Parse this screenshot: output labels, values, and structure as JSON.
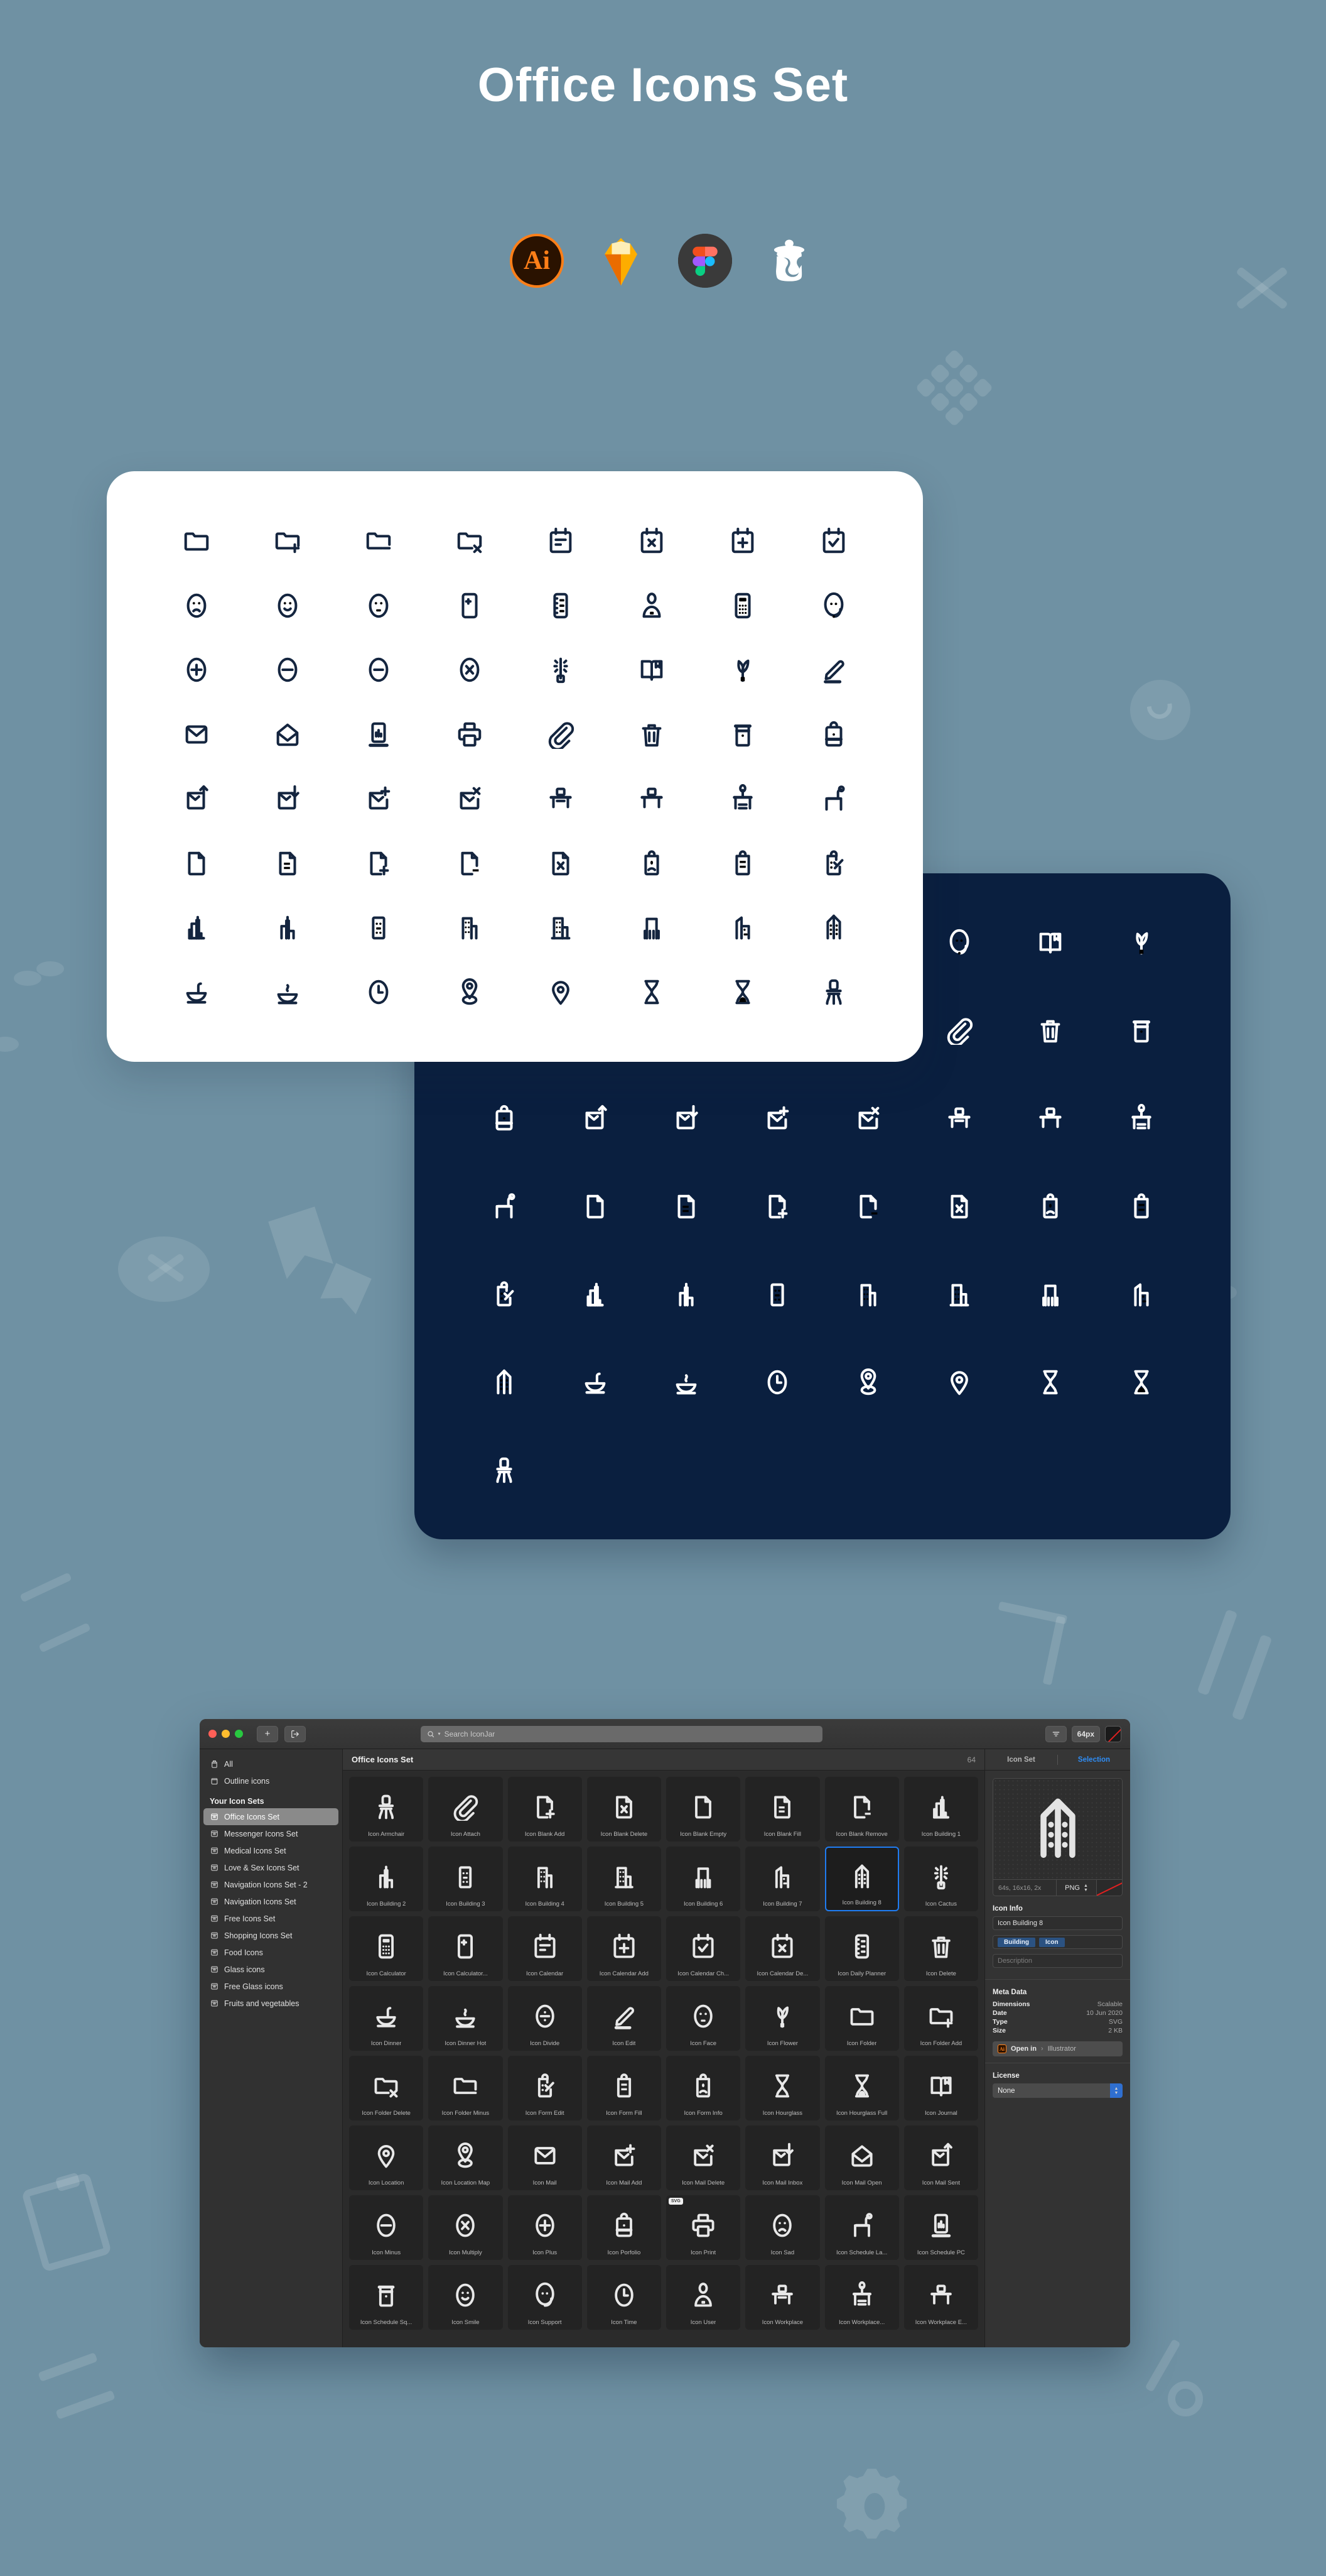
{
  "header": {
    "title": "Office Icons Set",
    "badges": [
      {
        "name": "adobe-illustrator",
        "label": "Ai"
      },
      {
        "name": "sketch",
        "label": "Sketch"
      },
      {
        "name": "figma",
        "label": "Figma"
      },
      {
        "name": "iconjar",
        "label": "IconJar"
      }
    ]
  },
  "cards": {
    "light": {
      "background": "#ffffff",
      "icon_color": "#14253f",
      "icons": [
        "folder",
        "folder-add",
        "folder-minus",
        "folder-delete",
        "calendar",
        "calendar-delete",
        "calendar-add",
        "calendar-check",
        "face-sad",
        "face-smile",
        "face-neutral",
        "calculator-plus-minus",
        "daily-planner",
        "user",
        "calculator",
        "support",
        "plus",
        "minus",
        "minus-2",
        "multiply",
        "cactus",
        "journal",
        "flower",
        "edit",
        "mail",
        "mail-open",
        "schedule-pc",
        "print",
        "attach",
        "delete",
        "schedule-square",
        "portfolio",
        "mail-sent",
        "mail-inbox",
        "mail-add",
        "mail-delete",
        "workplace",
        "workplace-empty",
        "workplace-lamp",
        "schedule-lamp",
        "blank-empty",
        "blank-fill",
        "blank-add",
        "blank-remove",
        "blank-delete",
        "form-info",
        "form-fill",
        "form-edit",
        "building-1",
        "building-2",
        "building-3",
        "building-4",
        "building-5",
        "building-6",
        "building-7",
        "building-8",
        "dinner",
        "dinner-hot",
        "time",
        "location-map",
        "location",
        "hourglass",
        "hourglass-full",
        "armchair"
      ]
    },
    "dark": {
      "background": "#0a1f3f",
      "icon_color": "#ffffff",
      "icons": [
        "calendar-delete",
        "calendar-add",
        "calendar-check",
        "user",
        "calculator",
        "support",
        "journal",
        "flower",
        "edit",
        "mail",
        "mail-open",
        "schedule-pc",
        "print",
        "attach",
        "delete",
        "schedule-square",
        "portfolio",
        "mail-sent",
        "mail-inbox",
        "mail-add",
        "mail-delete",
        "workplace",
        "workplace-empty",
        "workplace-lamp",
        "schedule-lamp",
        "blank-empty",
        "blank-fill",
        "blank-add",
        "blank-remove",
        "blank-delete",
        "form-info",
        "form-fill",
        "form-edit",
        "building-1",
        "building-2",
        "building-3",
        "building-4",
        "building-5",
        "building-6",
        "building-7",
        "building-8",
        "dinner",
        "dinner-hot",
        "time",
        "location-map",
        "location",
        "hourglass",
        "hourglass-full",
        "armchair"
      ]
    }
  },
  "app": {
    "toolbar": {
      "add_label": "+",
      "export_label": "export-icon",
      "search_placeholder": "Search IconJar",
      "search_value": "",
      "sort_label": "sort-icon",
      "size_label": "64px",
      "color_label": "color-swatch"
    },
    "sidebar": {
      "top_items": [
        {
          "label": "All",
          "icon": "jar-icon"
        },
        {
          "label": "Outline icons",
          "icon": "box-icon"
        }
      ],
      "group_title": "Your Icon Sets",
      "items": [
        {
          "label": "Office Icons Set",
          "selected": true
        },
        {
          "label": "Messenger Icons Set",
          "selected": false
        },
        {
          "label": "Medical Icons Set",
          "selected": false
        },
        {
          "label": "Love & Sex Icons Set",
          "selected": false
        },
        {
          "label": "Navigation Icons Set - 2",
          "selected": false
        },
        {
          "label": "Navigation Icons Set",
          "selected": false
        },
        {
          "label": "Free Icons Set",
          "selected": false
        },
        {
          "label": "Shopping Icons Set",
          "selected": false
        },
        {
          "label": "Food Icons",
          "selected": false
        },
        {
          "label": "Glass icons",
          "selected": false
        },
        {
          "label": "Free Glass icons",
          "selected": false
        },
        {
          "label": "Fruits and vegetables",
          "selected": false
        }
      ]
    },
    "main": {
      "title": "Office Icons Set",
      "count": "64",
      "icons": [
        {
          "label": "Icon Armchair",
          "shape": "armchair"
        },
        {
          "label": "Icon Attach",
          "shape": "attach"
        },
        {
          "label": "Icon Blank Add",
          "shape": "blank-add"
        },
        {
          "label": "Icon Blank Delete",
          "shape": "blank-delete"
        },
        {
          "label": "Icon Blank Empty",
          "shape": "blank-empty"
        },
        {
          "label": "Icon Blank Fill",
          "shape": "blank-fill"
        },
        {
          "label": "Icon Blank Remove",
          "shape": "blank-remove"
        },
        {
          "label": "Icon Building 1",
          "shape": "building-1"
        },
        {
          "label": "Icon Building 2",
          "shape": "building-2"
        },
        {
          "label": "Icon Building 3",
          "shape": "building-3"
        },
        {
          "label": "Icon Building 4",
          "shape": "building-4"
        },
        {
          "label": "Icon Building 5",
          "shape": "building-5"
        },
        {
          "label": "Icon Building 6",
          "shape": "building-6"
        },
        {
          "label": "Icon Building 7",
          "shape": "building-7"
        },
        {
          "label": "Icon Building 8",
          "shape": "building-8",
          "selected": true
        },
        {
          "label": "Icon Cactus",
          "shape": "cactus"
        },
        {
          "label": "Icon Calculator",
          "shape": "calculator"
        },
        {
          "label": "Icon Calculator...",
          "shape": "calculator-plus-minus"
        },
        {
          "label": "Icon Calendar",
          "shape": "calendar"
        },
        {
          "label": "Icon Calendar Add",
          "shape": "calendar-add"
        },
        {
          "label": "Icon Calendar Ch...",
          "shape": "calendar-check"
        },
        {
          "label": "Icon Calendar De...",
          "shape": "calendar-delete"
        },
        {
          "label": "Icon Daily Planner",
          "shape": "daily-planner"
        },
        {
          "label": "Icon Delete",
          "shape": "delete"
        },
        {
          "label": "Icon Dinner",
          "shape": "dinner"
        },
        {
          "label": "Icon Dinner Hot",
          "shape": "dinner-hot"
        },
        {
          "label": "Icon Divide",
          "shape": "divide"
        },
        {
          "label": "Icon Edit",
          "shape": "edit"
        },
        {
          "label": "Icon Face",
          "shape": "face-neutral"
        },
        {
          "label": "Icon Flower",
          "shape": "flower"
        },
        {
          "label": "Icon Folder",
          "shape": "folder"
        },
        {
          "label": "Icon Folder Add",
          "shape": "folder-add"
        },
        {
          "label": "Icon Folder Delete",
          "shape": "folder-delete"
        },
        {
          "label": "Icon Folder Minus",
          "shape": "folder-minus"
        },
        {
          "label": "Icon Form Edit",
          "shape": "form-edit"
        },
        {
          "label": "Icon Form Fill",
          "shape": "form-fill"
        },
        {
          "label": "Icon Form Info",
          "shape": "form-info"
        },
        {
          "label": "Icon Hourglass",
          "shape": "hourglass"
        },
        {
          "label": "Icon Hourglass Full",
          "shape": "hourglass-full"
        },
        {
          "label": "Icon Journal",
          "shape": "journal"
        },
        {
          "label": "Icon Location",
          "shape": "location"
        },
        {
          "label": "Icon Location Map",
          "shape": "location-map"
        },
        {
          "label": "Icon Mail",
          "shape": "mail"
        },
        {
          "label": "Icon Mail Add",
          "shape": "mail-add"
        },
        {
          "label": "Icon Mail Delete",
          "shape": "mail-delete"
        },
        {
          "label": "Icon Mail Inbox",
          "shape": "mail-inbox"
        },
        {
          "label": "Icon Mail Open",
          "shape": "mail-open"
        },
        {
          "label": "Icon Mail Sent",
          "shape": "mail-sent"
        },
        {
          "label": "Icon Minus",
          "shape": "minus"
        },
        {
          "label": "Icon Multiply",
          "shape": "multiply"
        },
        {
          "label": "Icon Plus",
          "shape": "plus"
        },
        {
          "label": "Icon Porfolio",
          "shape": "portfolio"
        },
        {
          "label": "Icon Print",
          "shape": "print",
          "tag": "SVG"
        },
        {
          "label": "Icon Sad",
          "shape": "face-sad"
        },
        {
          "label": "Icon Schedule La...",
          "shape": "schedule-lamp"
        },
        {
          "label": "Icon Schedule PC",
          "shape": "schedule-pc"
        },
        {
          "label": "Icon Schedule Sq...",
          "shape": "schedule-square"
        },
        {
          "label": "Icon Smile",
          "shape": "face-smile"
        },
        {
          "label": "Icon Support",
          "shape": "support"
        },
        {
          "label": "Icon Time",
          "shape": "time"
        },
        {
          "label": "Icon User",
          "shape": "user"
        },
        {
          "label": "Icon Workplace",
          "shape": "workplace"
        },
        {
          "label": "Icon Workplace...",
          "shape": "workplace-lamp"
        },
        {
          "label": "Icon Workplace E...",
          "shape": "workplace-empty"
        }
      ]
    },
    "inspector": {
      "tab_set": "Icon Set",
      "tab_selection": "Selection",
      "tab_active": "Selection",
      "preview_shape": "building-8",
      "preview_size": "64s, 16x16, 2x",
      "preview_format": "PNG",
      "icon_info_title": "Icon Info",
      "icon_name": "Icon Building 8",
      "tags": [
        "Building",
        "Icon"
      ],
      "description_placeholder": "Description",
      "description_value": "",
      "meta_title": "Meta Data",
      "meta": [
        {
          "key": "Dimensions",
          "value": "Scalable"
        },
        {
          "key": "Date",
          "value": "10 Jun 2020"
        },
        {
          "key": "Type",
          "value": "SVG"
        },
        {
          "key": "Size",
          "value": "2 KB"
        }
      ],
      "open_in_label": "Open in",
      "open_in_app": "Illustrator",
      "license_title": "License",
      "license_value": "None"
    }
  },
  "colors": {
    "page_bg": "#6f91a3",
    "card_dark": "#0a1f3f",
    "card_light": "#ffffff",
    "accent_blue": "#1f7cf2",
    "tag_blue": "#2b5282",
    "illustrator_orange": "#ff7f18"
  }
}
